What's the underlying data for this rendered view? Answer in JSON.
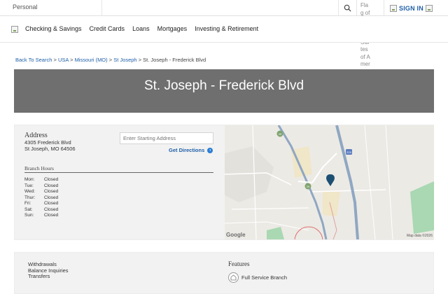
{
  "topbar": {
    "segment": "Personal",
    "flag_alt": "Flag of the United States of America",
    "signin_label": "SIGN IN"
  },
  "nav": {
    "items": [
      {
        "label": "Checking & Savings"
      },
      {
        "label": "Credit Cards"
      },
      {
        "label": "Loans"
      },
      {
        "label": "Mortgages"
      },
      {
        "label": "Investing & Retirement"
      }
    ]
  },
  "breadcrumb": {
    "back": "Back To Search",
    "country": "USA",
    "state": "Missouri (MO)",
    "city": "St Joseph",
    "current": "St. Joseph - Frederick Blvd",
    "separator": ">"
  },
  "page_title": "St. Joseph - Frederick Blvd",
  "address": {
    "title": "Address",
    "line1": "4305 Frederick Blvd",
    "line2": "St Joseph, MO 64506"
  },
  "directions": {
    "placeholder": "Enter Starting Address",
    "label": "Get Directions"
  },
  "hours": {
    "title": "Branch Hours",
    "days": [
      {
        "day": "Mon:",
        "value": "Closed"
      },
      {
        "day": "Tue:",
        "value": "Closed"
      },
      {
        "day": "Wed:",
        "value": "Closed"
      },
      {
        "day": "Thur:",
        "value": "Closed"
      },
      {
        "day": "Fri:",
        "value": "Closed"
      },
      {
        "day": "Sat:",
        "value": "Closed"
      },
      {
        "day": "Sun:",
        "value": "Closed"
      }
    ]
  },
  "map": {
    "google_label": "Google",
    "attribution": "Map data ©2026",
    "shields": [
      "29",
      "29",
      "229"
    ]
  },
  "services": {
    "items": [
      "Withdrawals",
      "Balance Inquiries",
      "Transfers"
    ]
  },
  "features": {
    "title": "Features",
    "items": [
      "Full Service Branch"
    ]
  },
  "colors": {
    "link": "#1f5fa8",
    "hero_bg": "#6f6f6f",
    "card_bg": "#f2f2f2",
    "pin": "#1d4f73"
  },
  "icons": {
    "search": "search-icon",
    "flag": "flag-icon",
    "signin": "user-icon",
    "logo": "logo-icon",
    "directions": "arrow-circle-icon",
    "pin": "map-pin-icon",
    "branch": "branch-icon"
  }
}
